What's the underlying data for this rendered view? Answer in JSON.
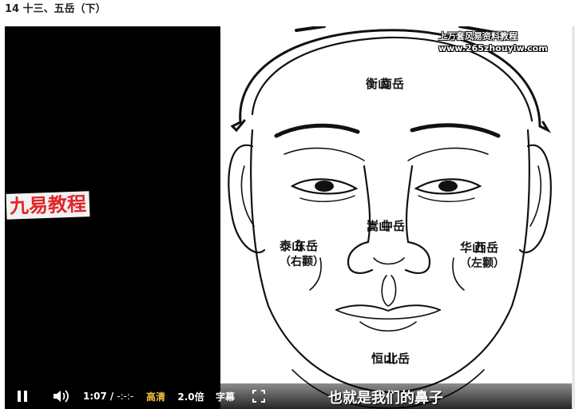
{
  "page": {
    "title": "14 十三、五岳（下）"
  },
  "watermark": {
    "line1": "上万套风易资料教程",
    "line2": "www.265zhouyiw.com"
  },
  "brand_stamp": "九易教程",
  "labels": {
    "nanyue": {
      "col1": "衡山",
      "col2": "南岳"
    },
    "zhongyue": {
      "col1": "嵩山",
      "col2": "中岳"
    },
    "dongyue": {
      "col1": "泰山",
      "col2": "东岳",
      "note": "（右颧）"
    },
    "xiyue": {
      "col1": "华山",
      "col2": "西岳",
      "note": "（左颧）"
    },
    "beiyue": {
      "col1": "恒山",
      "col2": "北岳"
    }
  },
  "controls": {
    "time_current": "1:07",
    "time_sep": "/",
    "time_total": "-:-:-",
    "quality": "高清",
    "speed": "2.0倍",
    "subtitle": "字幕"
  },
  "subtitle_text": "也就是我们的鼻子",
  "colors": {
    "quality_accent": "#f5c242",
    "stamp_red": "#e1262c"
  }
}
